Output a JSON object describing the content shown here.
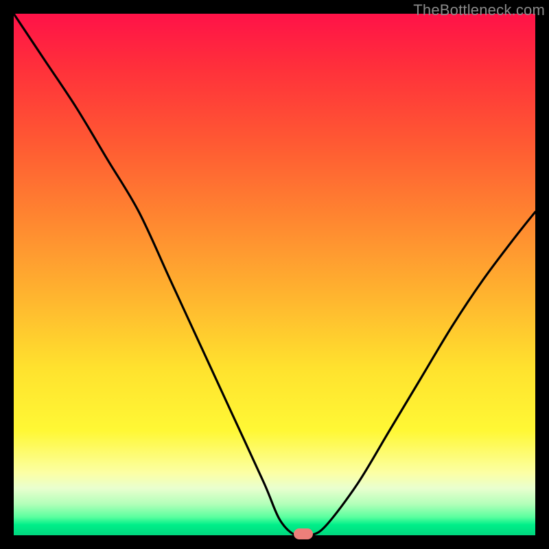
{
  "attribution": "TheBottleneck.com",
  "colors": {
    "frame_border": "#000000",
    "curve_stroke": "#000000",
    "marker": "#ec7f7a",
    "attribution_text": "#8a8a8a"
  },
  "chart_data": {
    "type": "line",
    "title": "",
    "xlabel": "",
    "ylabel": "",
    "xlim": [
      0,
      100
    ],
    "ylim": [
      0,
      100
    ],
    "series": [
      {
        "name": "bottleneck-curve",
        "x": [
          0,
          6,
          12,
          18,
          24,
          30,
          36,
          42,
          48,
          51,
          54,
          57,
          60,
          66,
          72,
          78,
          84,
          90,
          96,
          100
        ],
        "values": [
          100,
          91,
          82,
          72,
          62,
          49,
          36,
          23,
          10,
          3,
          0,
          0,
          2,
          10,
          20,
          30,
          40,
          49,
          57,
          62
        ]
      }
    ],
    "marker": {
      "x": 55.5,
      "y": 0
    },
    "background_gradient": {
      "stops": [
        {
          "pos": 0.0,
          "color": "#ff1248"
        },
        {
          "pos": 0.1,
          "color": "#ff2f3b"
        },
        {
          "pos": 0.24,
          "color": "#ff5733"
        },
        {
          "pos": 0.4,
          "color": "#ff8830"
        },
        {
          "pos": 0.55,
          "color": "#ffb72f"
        },
        {
          "pos": 0.68,
          "color": "#ffe22e"
        },
        {
          "pos": 0.8,
          "color": "#fff835"
        },
        {
          "pos": 0.88,
          "color": "#fcffa4"
        },
        {
          "pos": 0.91,
          "color": "#e9ffcf"
        },
        {
          "pos": 0.94,
          "color": "#b3ffb9"
        },
        {
          "pos": 0.965,
          "color": "#5bff9f"
        },
        {
          "pos": 0.98,
          "color": "#00ef89"
        },
        {
          "pos": 1.0,
          "color": "#00d77e"
        }
      ]
    }
  }
}
